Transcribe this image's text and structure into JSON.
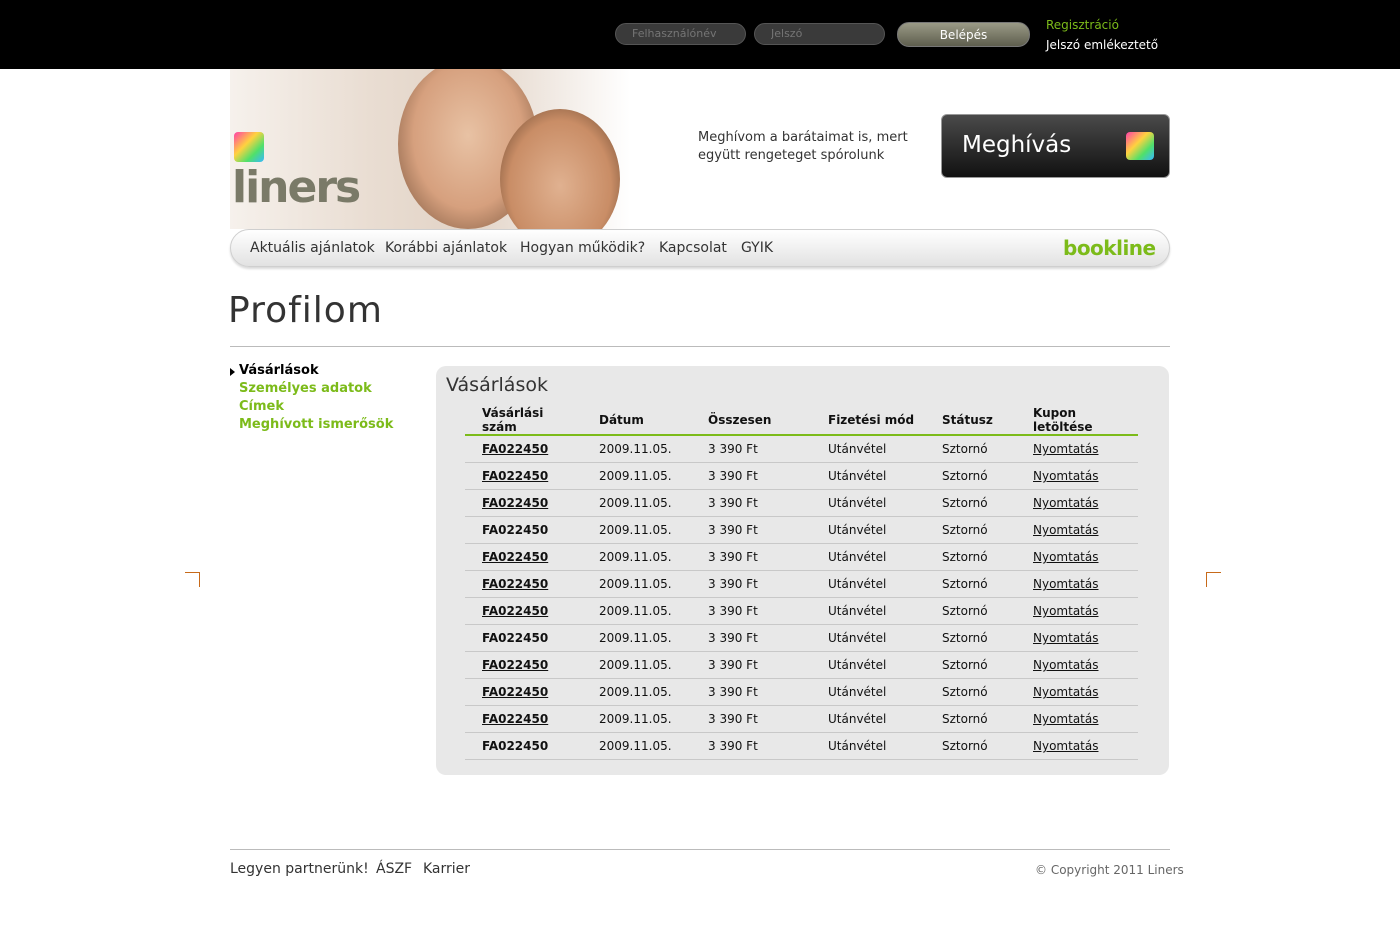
{
  "header": {
    "username_placeholder": "Felhasználónév",
    "password_placeholder": "Jelszó",
    "login_label": "Belépés",
    "register_link": "Regisztráció",
    "password_reminder_link": "Jelszó emlékeztető"
  },
  "brand": {
    "logo_text": "liners",
    "invite_text": "Meghívom a barátaimat is, mert együtt rengeteget spórolunk",
    "invite_button": "Meghívás",
    "partner_logo": "bookline"
  },
  "nav": {
    "items": [
      "Aktuális ajánlatok",
      "Korábbi ajánlatok",
      "Hogyan működik?",
      "Kapcsolat",
      "GYIK"
    ]
  },
  "page": {
    "title": "Profilom"
  },
  "sidebar": {
    "items": [
      {
        "label": "Vásárlások",
        "active": true
      },
      {
        "label": "Személyes adatok",
        "active": false
      },
      {
        "label": "Címek",
        "active": false
      },
      {
        "label": "Meghívott ismerősök",
        "active": false
      }
    ]
  },
  "purchases": {
    "title": "Vásárlások",
    "columns": [
      "Vásárlási szám",
      "Dátum",
      "Összesen",
      "Fizetési mód",
      "Státusz",
      "Kupon letöltése"
    ],
    "rows": [
      {
        "id": "FA022450",
        "date": "2009.11.05.",
        "total": "3 390 Ft",
        "payment": "Utánvétel",
        "status": "Sztornó",
        "coupon": "Nyomtatás",
        "id_link": true
      },
      {
        "id": "FA022450",
        "date": "2009.11.05.",
        "total": "3 390 Ft",
        "payment": "Utánvétel",
        "status": "Sztornó",
        "coupon": "Nyomtatás",
        "id_link": true
      },
      {
        "id": "FA022450",
        "date": "2009.11.05.",
        "total": "3 390 Ft",
        "payment": "Utánvétel",
        "status": "Sztornó",
        "coupon": "Nyomtatás",
        "id_link": true
      },
      {
        "id": "FA022450",
        "date": "2009.11.05.",
        "total": "3 390 Ft",
        "payment": "Utánvétel",
        "status": "Sztornó",
        "coupon": "Nyomtatás",
        "id_link": false
      },
      {
        "id": "FA022450",
        "date": "2009.11.05.",
        "total": "3 390 Ft",
        "payment": "Utánvétel",
        "status": "Sztornó",
        "coupon": "Nyomtatás",
        "id_link": true
      },
      {
        "id": "FA022450",
        "date": "2009.11.05.",
        "total": "3 390 Ft",
        "payment": "Utánvétel",
        "status": "Sztornó",
        "coupon": "Nyomtatás",
        "id_link": true
      },
      {
        "id": "FA022450",
        "date": "2009.11.05.",
        "total": "3 390 Ft",
        "payment": "Utánvétel",
        "status": "Sztornó",
        "coupon": "Nyomtatás",
        "id_link": true
      },
      {
        "id": "FA022450",
        "date": "2009.11.05.",
        "total": "3 390 Ft",
        "payment": "Utánvétel",
        "status": "Sztornó",
        "coupon": "Nyomtatás",
        "id_link": false
      },
      {
        "id": "FA022450",
        "date": "2009.11.05.",
        "total": "3 390 Ft",
        "payment": "Utánvétel",
        "status": "Sztornó",
        "coupon": "Nyomtatás",
        "id_link": true
      },
      {
        "id": "FA022450",
        "date": "2009.11.05.",
        "total": "3 390 Ft",
        "payment": "Utánvétel",
        "status": "Sztornó",
        "coupon": "Nyomtatás",
        "id_link": true
      },
      {
        "id": "FA022450",
        "date": "2009.11.05.",
        "total": "3 390 Ft",
        "payment": "Utánvétel",
        "status": "Sztornó",
        "coupon": "Nyomtatás",
        "id_link": true
      },
      {
        "id": "FA022450",
        "date": "2009.11.05.",
        "total": "3 390 Ft",
        "payment": "Utánvétel",
        "status": "Sztornó",
        "coupon": "Nyomtatás",
        "id_link": false
      }
    ]
  },
  "footer": {
    "links": [
      "Legyen partnerünk!",
      "ÁSZF",
      "Karrier"
    ],
    "copyright": "© Copyright 2011 Liners"
  },
  "colors": {
    "accent": "#7cbb1a",
    "topbar": "#000000",
    "panel": "#e8e8e8"
  }
}
